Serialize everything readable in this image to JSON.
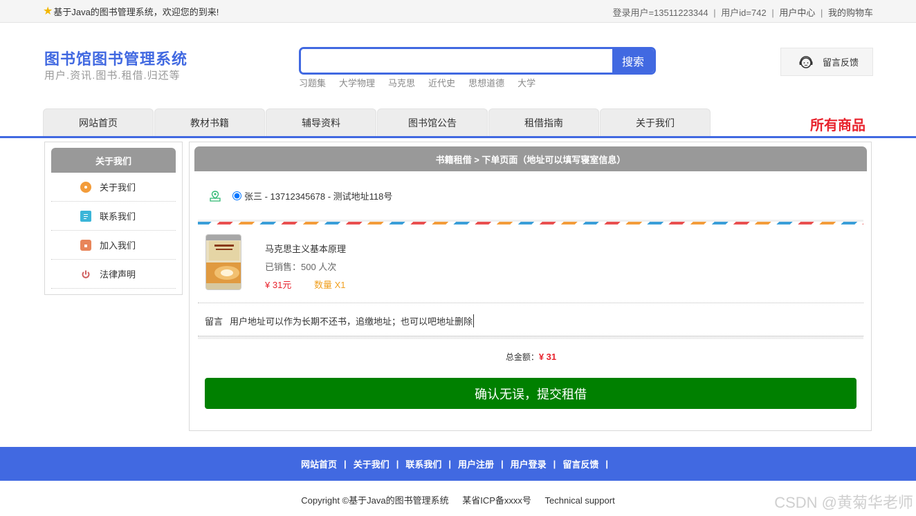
{
  "topbar": {
    "welcome": "基于Java的图书管理系统，欢迎您的到来!",
    "login_user": "登录用户=13511223344",
    "user_id": "用户id=742",
    "user_center": "用户中心",
    "cart": "我的购物车",
    "sep": "|"
  },
  "header": {
    "title": "图书馆图书管理系统",
    "subtitle": "用户.资讯.图书.租借.归还等",
    "search_button": "搜索",
    "search_value": "",
    "hot_words": [
      "习题集",
      "大学物理",
      "马克思",
      "近代史",
      "思想道德",
      "大学"
    ],
    "feedback": "留言反馈"
  },
  "nav": {
    "tabs": [
      "网站首页",
      "教材书籍",
      "辅导资料",
      "图书馆公告",
      "租借指南",
      "关于我们"
    ],
    "all_goods": "所有商品"
  },
  "sidebar": {
    "title": "关于我们",
    "items": [
      {
        "label": "关于我们",
        "icon": "about-icon",
        "color": "#f39c3a"
      },
      {
        "label": "联系我们",
        "icon": "clipboard-icon",
        "color": "#3bb5d8"
      },
      {
        "label": "加入我们",
        "icon": "lock-icon",
        "color": "#e8855a"
      },
      {
        "label": "法律声明",
        "icon": "power-icon",
        "color": "#d06060"
      }
    ]
  },
  "order": {
    "heading": "书籍租借 > 下单页面（地址可以填写寝室信息）",
    "address": "张三 - 13712345678 - 测试地址118号",
    "book": {
      "name": "马克思主义基本原理",
      "sold": "已销售：500 人次",
      "price": "¥ 31元",
      "qty": "数量 X1"
    },
    "memo_label": "留言",
    "memo_text": "用户地址可以作为长期不还书，追缴地址；也可以吧地址删除",
    "total_label": "总金额：",
    "total_amount": "¥ 31",
    "submit": "确认无误，提交租借"
  },
  "footer": {
    "links": [
      "网站首页",
      "关于我们",
      "联系我们",
      "用户注册",
      "用户登录",
      "留言反馈"
    ],
    "copyright": "Copyright ©基于Java的图书管理系统",
    "icp": "某省ICP备xxxx号",
    "support": "Technical support",
    "watermark": "CSDN @黄菊华老师"
  },
  "colors": {
    "brand": "#4169e1",
    "red": "#e8232d",
    "green": "#008000"
  }
}
